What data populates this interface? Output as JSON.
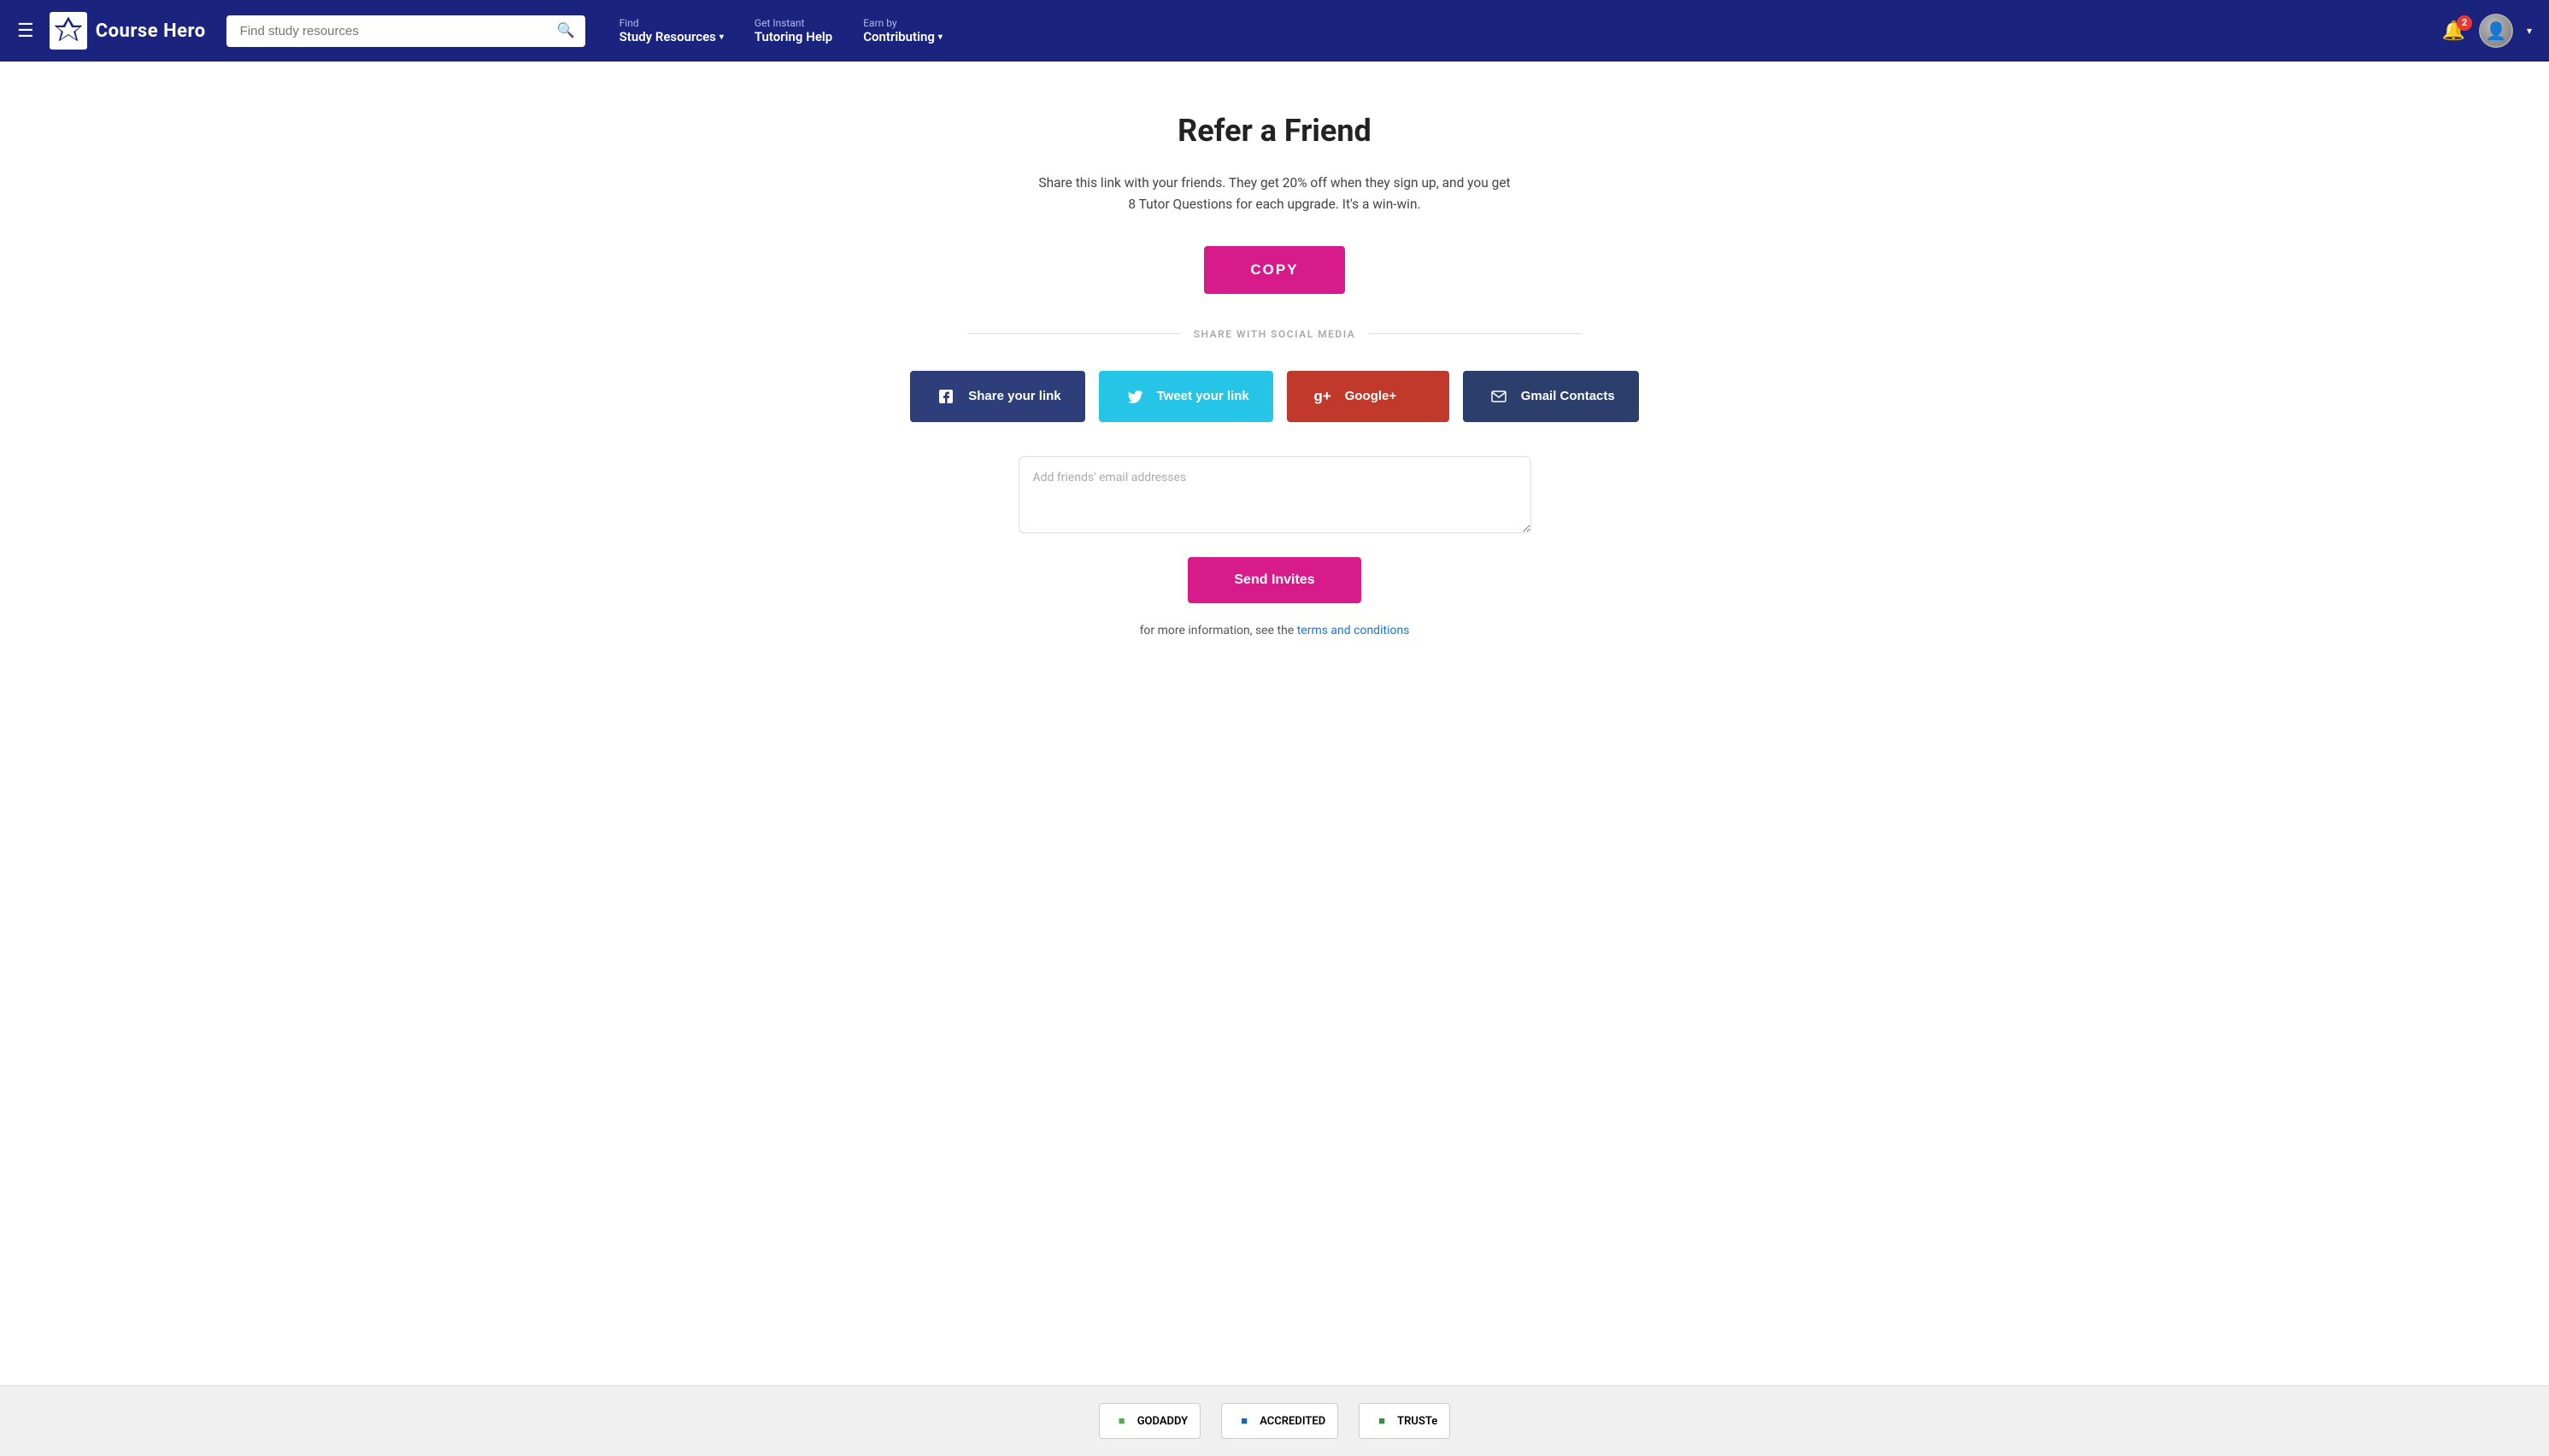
{
  "navbar": {
    "logo_text": "Course Hero",
    "search_placeholder": "Find study resources",
    "nav_find_sub": "Find",
    "nav_find_main": "Study Resources",
    "nav_tutoring_sub": "Get Instant",
    "nav_tutoring_main": "Tutoring Help",
    "nav_earn_sub": "Earn by",
    "nav_earn_main": "Contributing",
    "bell_badge": "2",
    "chevron": "▾"
  },
  "page": {
    "title": "Refer a Friend",
    "subtitle": "Share this link with your friends. They get 20% off when they sign up, and you get 8 Tutor Questions for each upgrade. It's a win-win.",
    "copy_button": "COPY",
    "divider_text": "SHARE WITH SOCIAL MEDIA",
    "facebook_btn": "Share your link",
    "twitter_btn": "Tweet your link",
    "googleplus_btn": "Google+",
    "gmail_btn": "Gmail Contacts",
    "email_placeholder": "Add friends' email addresses",
    "send_button": "Send Invites",
    "terms_pre": "for more information, see the ",
    "terms_link": "terms and conditions"
  },
  "footer": {
    "godaddy_text": "GODADDY",
    "bbb_text": "ACCREDITED",
    "truste_text": "TRUSTe"
  }
}
